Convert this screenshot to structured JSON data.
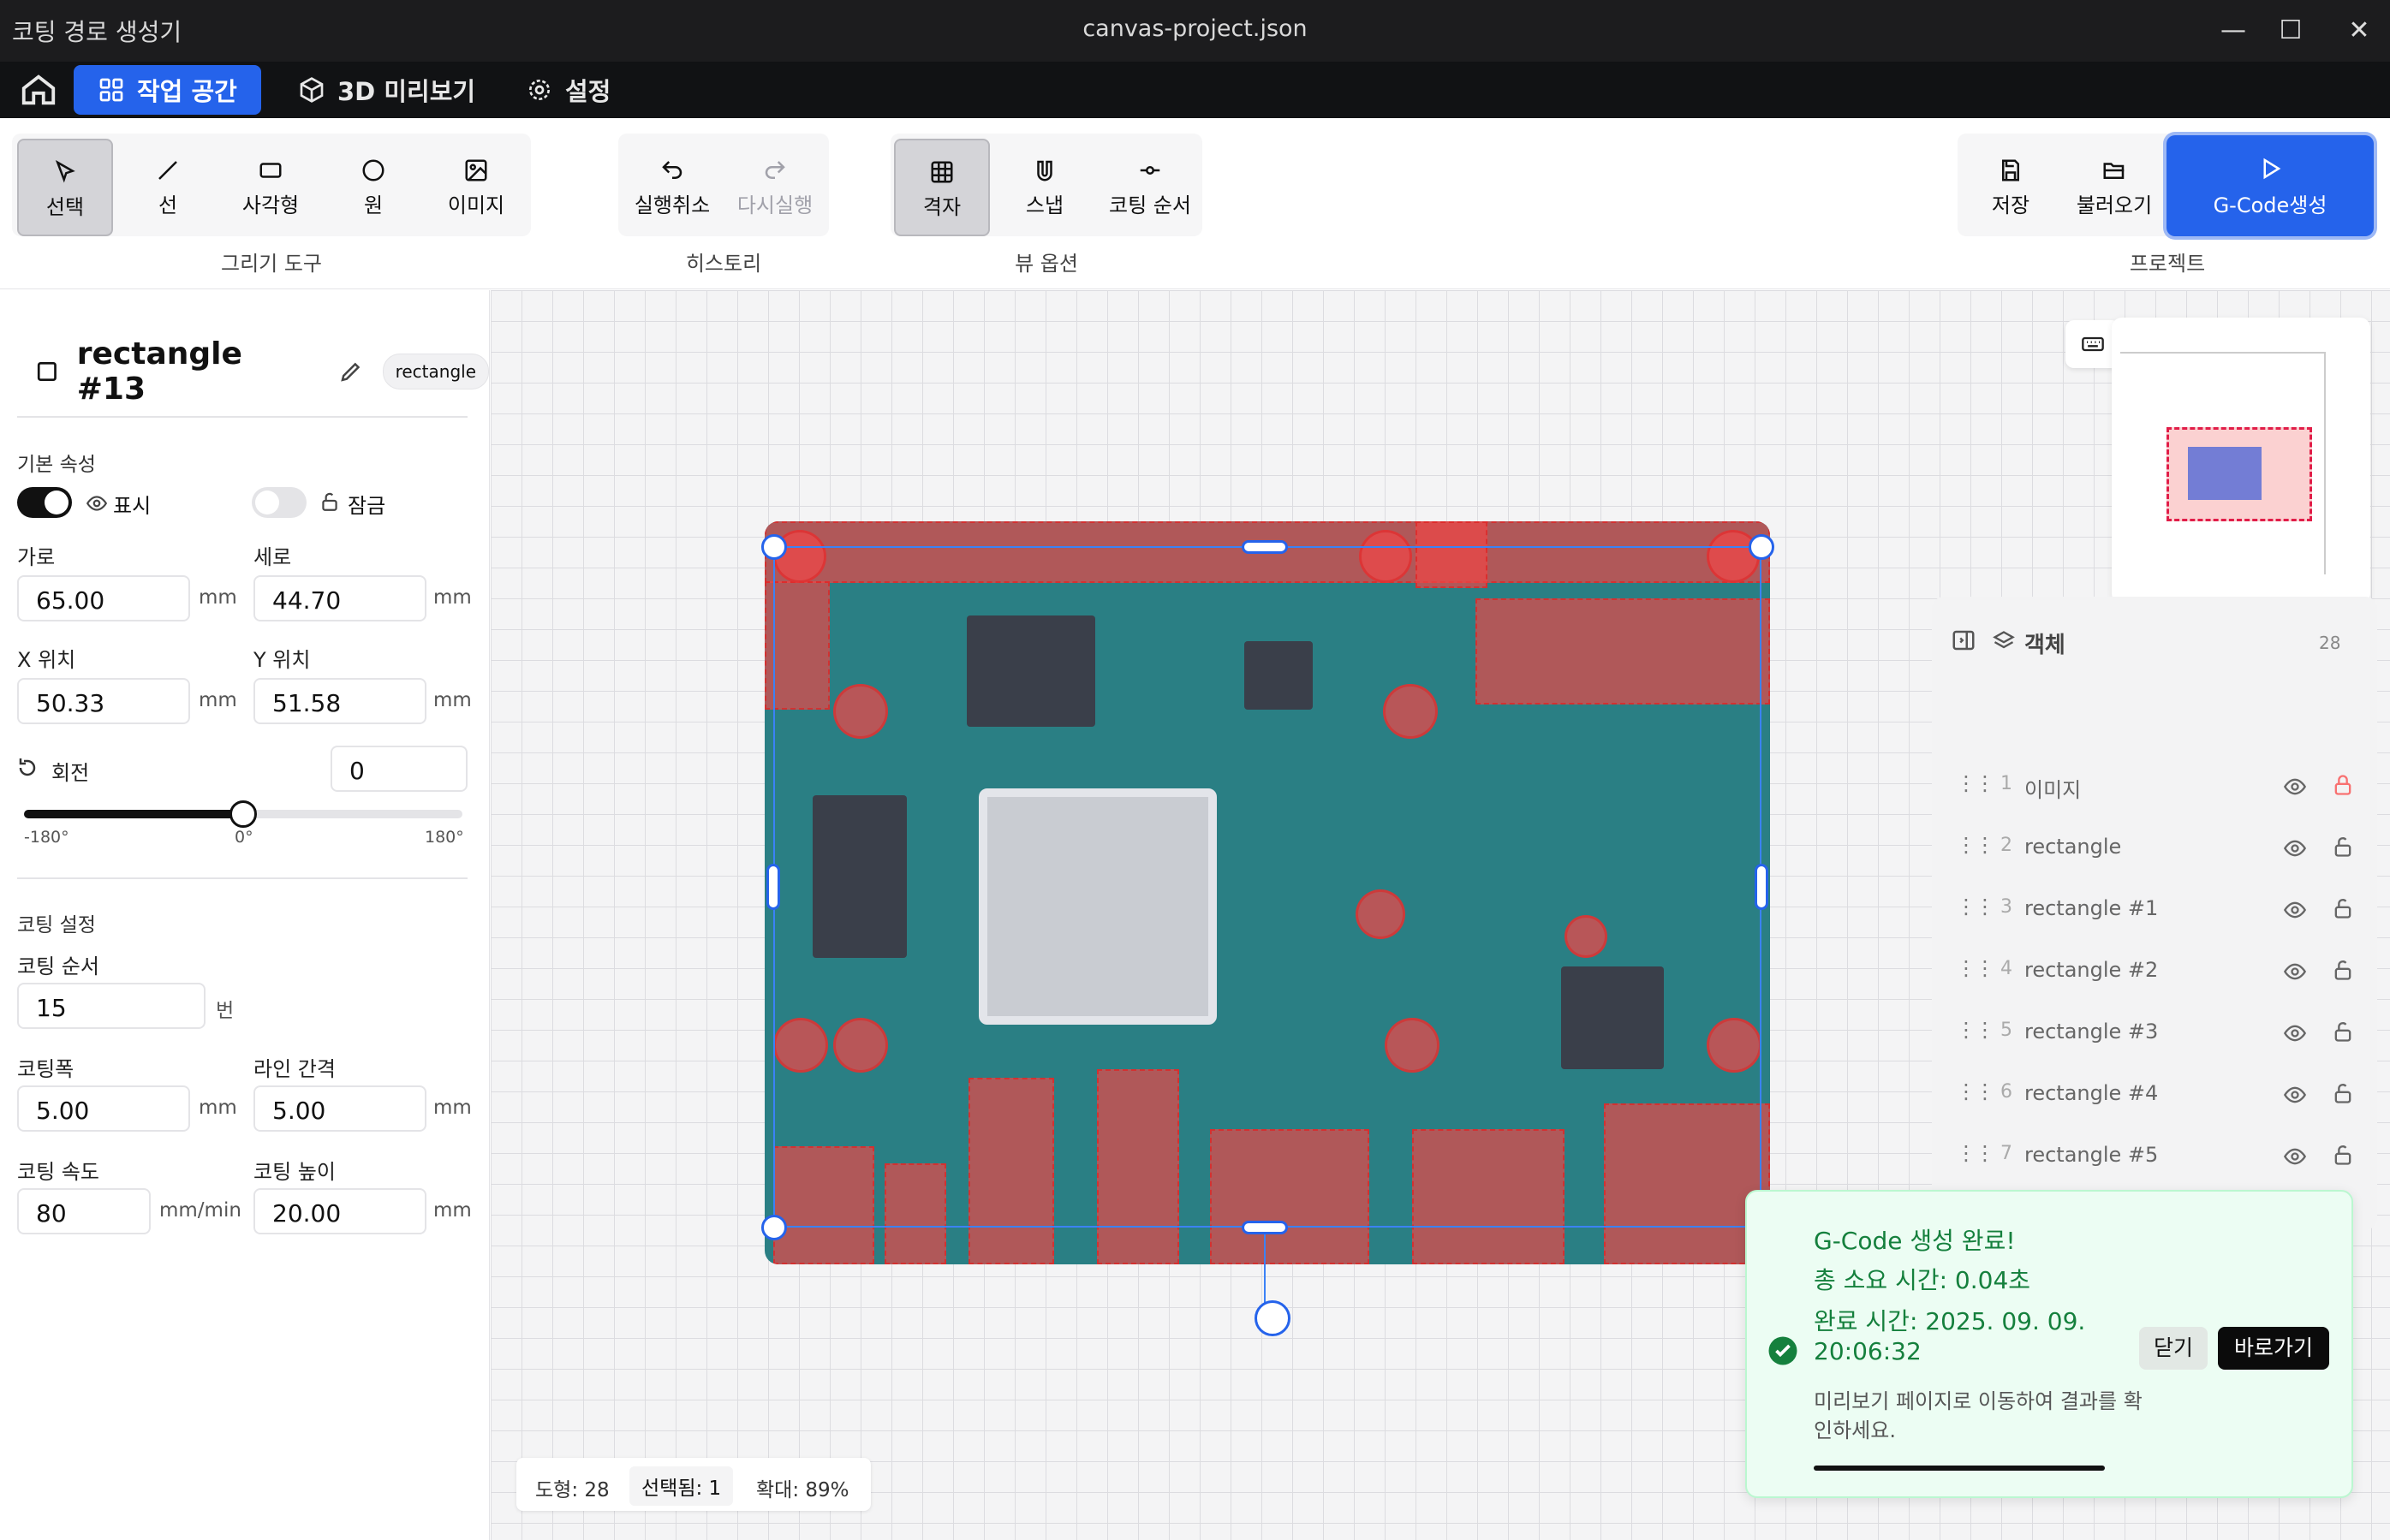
{
  "window": {
    "app_title": "코팅 경로 생성기",
    "file_title": "canvas-project.json"
  },
  "nav": {
    "workspace": "작업 공간",
    "preview3d": "3D 미리보기",
    "settings": "설정"
  },
  "toolbar": {
    "draw": {
      "select": "선택",
      "line": "선",
      "rect": "사각형",
      "circle": "원",
      "image": "이미지",
      "group_label": "그리기 도구"
    },
    "history": {
      "undo": "실행취소",
      "redo": "다시실행",
      "group_label": "히스토리"
    },
    "view": {
      "grid": "격자",
      "snap": "스냅",
      "order": "코팅 순서",
      "group_label": "뷰 옵션"
    },
    "project": {
      "save": "저장",
      "load": "불러오기",
      "gcode": "G-Code생성",
      "group_label": "프로젝트"
    }
  },
  "props": {
    "title": "rectangle #13",
    "type_badge": "rectangle",
    "basic_section": "기본 속성",
    "visible_label": "표시",
    "visible": true,
    "lock_label": "잠금",
    "locked": false,
    "width_label": "가로",
    "width": "65.00",
    "height_label": "세로",
    "height": "44.70",
    "x_label": "X 위치",
    "x": "50.33",
    "y_label": "Y 위치",
    "y": "51.58",
    "unit_mm": "mm",
    "rotation_label": "회전",
    "rotation": "0",
    "rot_min": "-180°",
    "rot_mid": "0°",
    "rot_max": "180°",
    "coating_section": "코팅 설정",
    "order_label": "코팅 순서",
    "order": "15",
    "order_unit": "번",
    "cwidth_label": "코팅폭",
    "cwidth": "5.00",
    "spacing_label": "라인 간격",
    "spacing": "5.00",
    "speed_label": "코팅 속도",
    "speed": "80",
    "speed_unit": "mm/min",
    "cheight_label": "코팅 높이",
    "cheight": "20.00"
  },
  "objects": {
    "title": "객체",
    "count": "28",
    "items": [
      {
        "num": "1",
        "name": "이미지",
        "locked": true
      },
      {
        "num": "2",
        "name": "rectangle",
        "locked": false
      },
      {
        "num": "3",
        "name": "rectangle #1",
        "locked": false
      },
      {
        "num": "4",
        "name": "rectangle #2",
        "locked": false
      },
      {
        "num": "5",
        "name": "rectangle #3",
        "locked": false
      },
      {
        "num": "6",
        "name": "rectangle #4",
        "locked": false
      },
      {
        "num": "7",
        "name": "rectangle #5",
        "locked": false
      }
    ]
  },
  "status": {
    "shapes": "도형: 28",
    "selected": "선택됨: 1",
    "zoom": "확대: 89%"
  },
  "toast": {
    "line1": "G-Code 생성 완료!",
    "line2": "총 소요 시간: 0.04초",
    "line3": "완료 시간: 2025. 09. 09.",
    "line4": "20:06:32",
    "desc": "미리보기 페이지로 이동하여 결과를 확인하세요.",
    "close": "닫기",
    "goto": "바로가기"
  },
  "colors": {
    "accent": "#2563eb",
    "success": "#15803d",
    "coating": "#f04646"
  }
}
